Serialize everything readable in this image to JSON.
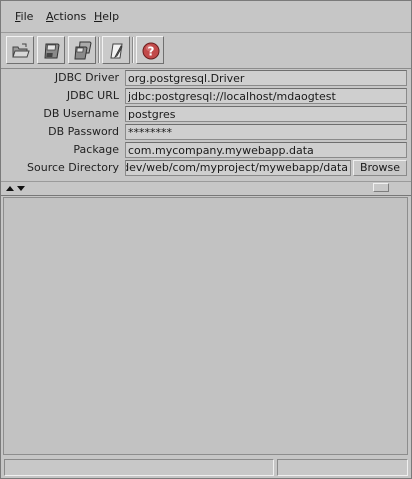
{
  "menu": {
    "file": {
      "mnemonic": "F",
      "rest": "ile"
    },
    "actions": {
      "mnemonic": "A",
      "rest": "ctions"
    },
    "help": {
      "mnemonic": "H",
      "rest": "elp"
    }
  },
  "toolbar": {
    "buttons": [
      {
        "icon": "open-folder-icon"
      },
      {
        "icon": "save-icon"
      },
      {
        "icon": "save-all-icon"
      },
      {
        "icon": "edit-document-icon"
      },
      {
        "icon": "help-icon"
      }
    ]
  },
  "form": {
    "jdbc_driver": {
      "label": "JDBC Driver",
      "value": "org.postgresql.Driver"
    },
    "jdbc_url": {
      "label": "JDBC URL",
      "value": "jdbc:postgresql://localhost/mdaogtest"
    },
    "db_username": {
      "label": "DB Username",
      "value": "postgres"
    },
    "db_password": {
      "label": "DB Password",
      "value": "********"
    },
    "package": {
      "label": "Package",
      "value": "com.mycompany.mywebapp.data"
    },
    "source_directory": {
      "label": "Source Directory",
      "value": "e/user/dev/web/com/myproject/mywebapp/data",
      "browse_label": "Browse"
    }
  },
  "status": {
    "left": "",
    "right": ""
  }
}
